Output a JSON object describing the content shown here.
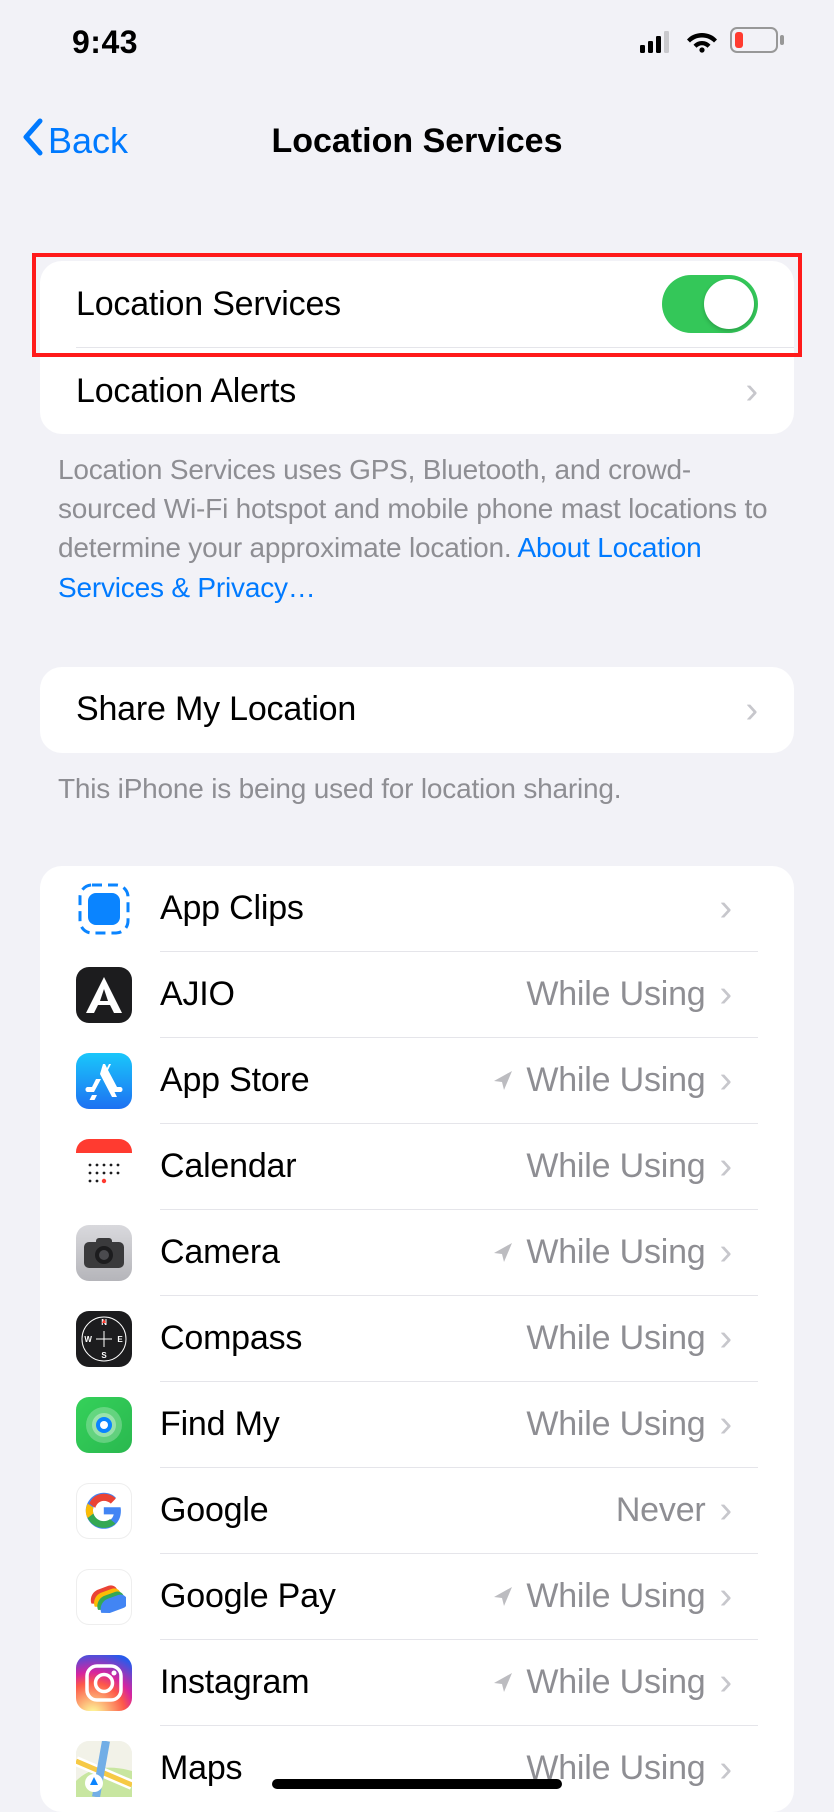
{
  "status": {
    "time": "9:43"
  },
  "nav": {
    "back": "Back",
    "title": "Location Services"
  },
  "toggle_row": {
    "label": "Location Services",
    "on": true
  },
  "alerts_row": {
    "label": "Location Alerts"
  },
  "description": {
    "text": "Location Services uses GPS, Bluetooth, and crowd-sourced Wi-Fi hotspot and mobile phone mast locations to determine your approximate location. ",
    "link": "About Location Services & Privacy…"
  },
  "share": {
    "label": "Share My Location",
    "footer": "This iPhone is being used for location sharing."
  },
  "apps": [
    {
      "name": "App Clips",
      "value": "",
      "arrow": false,
      "icon": "appclips"
    },
    {
      "name": "AJIO",
      "value": "While Using",
      "arrow": false,
      "icon": "ajio"
    },
    {
      "name": "App Store",
      "value": "While Using",
      "arrow": true,
      "icon": "appstore"
    },
    {
      "name": "Calendar",
      "value": "While Using",
      "arrow": false,
      "icon": "calendar"
    },
    {
      "name": "Camera",
      "value": "While Using",
      "arrow": true,
      "icon": "camera"
    },
    {
      "name": "Compass",
      "value": "While Using",
      "arrow": false,
      "icon": "compass"
    },
    {
      "name": "Find My",
      "value": "While Using",
      "arrow": false,
      "icon": "findmy"
    },
    {
      "name": "Google",
      "value": "Never",
      "arrow": false,
      "icon": "google"
    },
    {
      "name": "Google Pay",
      "value": "While Using",
      "arrow": true,
      "icon": "gpay"
    },
    {
      "name": "Instagram",
      "value": "While Using",
      "arrow": true,
      "icon": "instagram"
    },
    {
      "name": "Maps",
      "value": "While Using",
      "arrow": false,
      "icon": "maps"
    }
  ]
}
